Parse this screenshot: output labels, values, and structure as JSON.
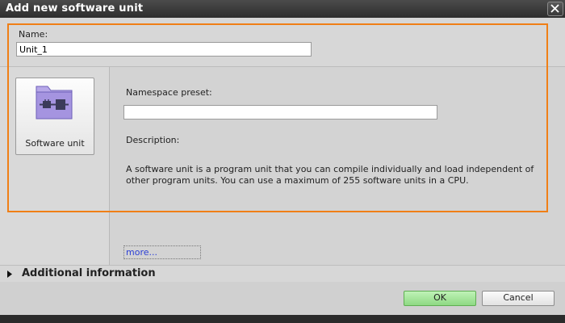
{
  "window": {
    "title": "Add new software unit"
  },
  "name_field": {
    "label": "Name:",
    "value": "Unit_1"
  },
  "unit_tile": {
    "label": "Software unit",
    "icon": "software-unit-icon"
  },
  "namespace": {
    "label": "Namespace preset:",
    "value": ""
  },
  "description": {
    "label": "Description:",
    "text": "A software unit is a program unit that you can compile individually and load independent of other program units. You can use a maximum of 255 software units in a CPU."
  },
  "more_link": "more...",
  "additional_info": {
    "label": "Additional information",
    "icon": "triangle-right-icon"
  },
  "buttons": {
    "ok": "OK",
    "cancel": "Cancel"
  },
  "colors": {
    "highlight": "#f07f16",
    "ok_button": "#a6e69b",
    "link": "#2b3fd6",
    "titlebar": "#3a3a3a"
  }
}
